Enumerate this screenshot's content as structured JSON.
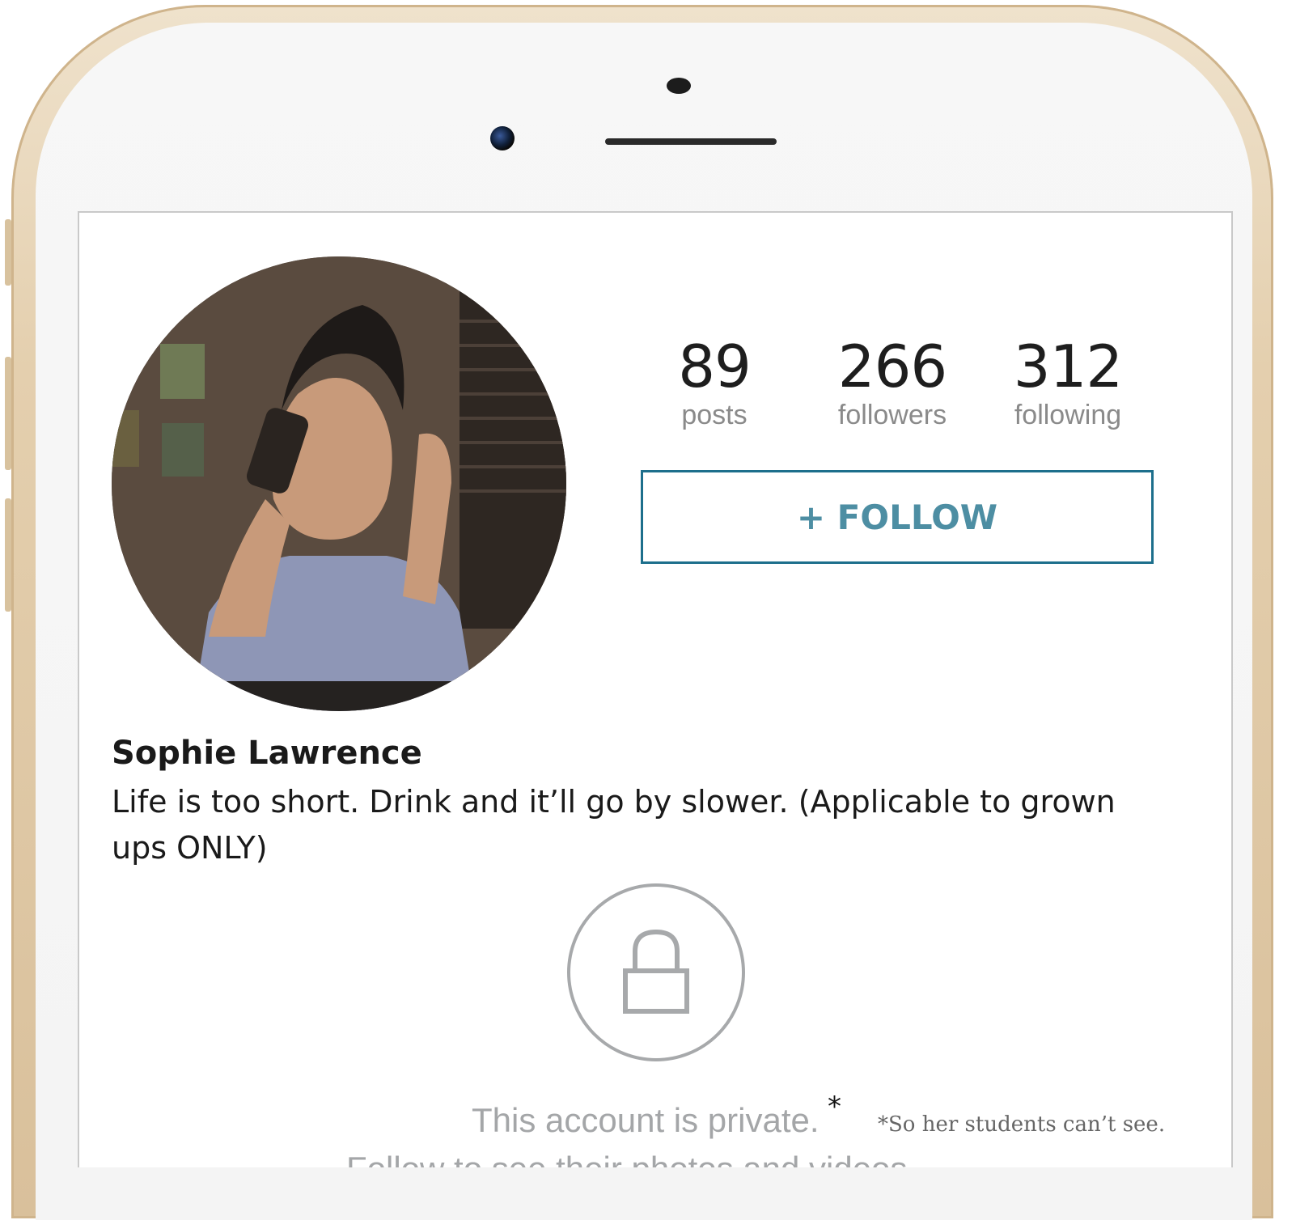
{
  "profile": {
    "name": "Sophie Lawrence",
    "bio": "Life is too short. Drink and it’ll go by slower. (Applicable to grown ups ONLY)"
  },
  "stats": [
    {
      "value": "89",
      "label": "posts"
    },
    {
      "value": "266",
      "label": "followers"
    },
    {
      "value": "312",
      "label": "following"
    }
  ],
  "follow_button": {
    "label": "+ FOLLOW"
  },
  "privacy": {
    "message": "This account is private.",
    "asterisk": "*",
    "footnote": "*So her students can’t see.",
    "cutoff_line": "Follow to see their photos and videos."
  },
  "colors": {
    "accent_border": "#1d6f8c",
    "accent_text": "#4d8ea3",
    "muted_text": "#a4a6a8"
  },
  "icons": {
    "lock": "lock-icon"
  }
}
